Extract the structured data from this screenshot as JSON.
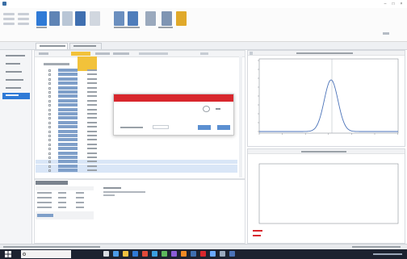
{
  "window": {
    "title": "",
    "controls": {
      "minimize": "–",
      "maximize": "□",
      "close": "×"
    }
  },
  "ribbon": {
    "buttons": [
      "",
      "",
      "",
      "",
      "",
      "",
      "",
      "",
      "",
      "",
      "",
      "",
      "",
      ""
    ]
  },
  "tabs": [
    "",
    ""
  ],
  "leftnav": {
    "items": [
      "",
      "",
      "",
      "",
      "",
      ""
    ],
    "active_index": 5
  },
  "samplelist": {
    "columns": [
      "",
      "",
      ""
    ],
    "rows": [
      {
        "name": "",
        "value": ""
      },
      {
        "name": "",
        "value": ""
      },
      {
        "name": "",
        "value": ""
      },
      {
        "name": "",
        "value": ""
      },
      {
        "name": "",
        "value": ""
      },
      {
        "name": "",
        "value": ""
      },
      {
        "name": "",
        "value": ""
      },
      {
        "name": "",
        "value": ""
      },
      {
        "name": "",
        "value": ""
      },
      {
        "name": "",
        "value": ""
      },
      {
        "name": "",
        "value": ""
      },
      {
        "name": "",
        "value": ""
      },
      {
        "name": "",
        "value": ""
      },
      {
        "name": "",
        "value": ""
      },
      {
        "name": "",
        "value": ""
      },
      {
        "name": "",
        "value": ""
      },
      {
        "name": "",
        "value": ""
      },
      {
        "name": "",
        "value": ""
      },
      {
        "name": "",
        "value": ""
      },
      {
        "name": "",
        "value": ""
      },
      {
        "name": "",
        "value": ""
      },
      {
        "name": "",
        "value": ""
      },
      {
        "name": "",
        "value": ""
      },
      {
        "name": "",
        "value": ""
      }
    ]
  },
  "dialog": {
    "title": "",
    "message": "",
    "field_label": "",
    "ok_label": "",
    "cancel_label": ""
  },
  "plots": {
    "top_title": "",
    "bottom_title": "",
    "top_xlabel": "",
    "top_ylabel": "",
    "bottom_xlabel": "",
    "bottom_ylabel": "",
    "bottom_status": ""
  },
  "bottompanel": {
    "header": [
      "",
      "",
      ""
    ],
    "rows": [
      [
        "",
        "",
        ""
      ],
      [
        "",
        "",
        ""
      ],
      [
        "",
        "",
        ""
      ],
      [
        "",
        "",
        ""
      ]
    ],
    "info_title": "",
    "info_lines": [
      "",
      ""
    ]
  },
  "taskbar": {
    "search_placeholder": ""
  },
  "colors": {
    "accent": "#2f7ad6",
    "dialog_title": "#d8272d",
    "active_nav": "#2f7ad6",
    "curve": "#4a72b8"
  },
  "icons": [
    "app-icon",
    "search-icon",
    "windows-start-icon"
  ]
}
